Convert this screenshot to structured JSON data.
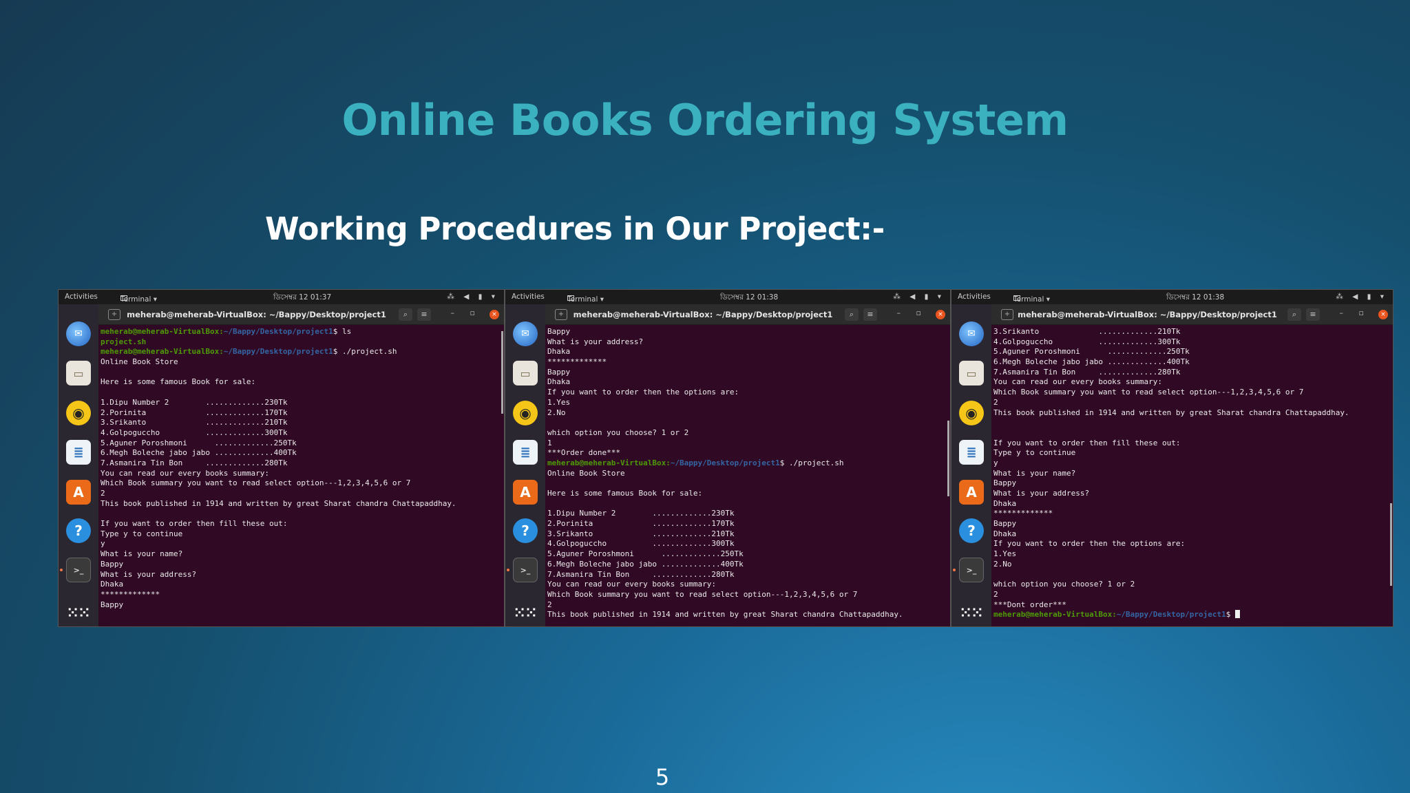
{
  "slide": {
    "title": "Online Books Ordering System",
    "subtitle": "Working Procedures in Our Project:-",
    "page_number": "5"
  },
  "common": {
    "activities": "Activities",
    "terminal_menu": "Terminal ▾",
    "window_title": "meherab@meherab-VirtualBox: ~/Bappy/Desktop/project1",
    "prompt_user": "meherab@meherab-VirtualBox",
    "prompt_path": "~/Bappy/Desktop/project1",
    "tray_icons": "⁂ ◀ ▮ ▾"
  },
  "screenshots": [
    {
      "clock": "ডিসেম্বর 12  01:37",
      "lines": [
        {
          "type": "prompt",
          "cmd": " ls"
        },
        {
          "type": "green",
          "text": "project.sh"
        },
        {
          "type": "prompt",
          "cmd": " ./project.sh"
        },
        {
          "type": "text",
          "text": "Online Book Store"
        },
        {
          "type": "text",
          "text": ""
        },
        {
          "type": "text",
          "text": "Here is some famous Book for sale:"
        },
        {
          "type": "text",
          "text": ""
        },
        {
          "type": "text",
          "text": "1.Dipu Number 2        .............230Tk"
        },
        {
          "type": "text",
          "text": "2.Porinita             .............170Tk"
        },
        {
          "type": "text",
          "text": "3.Srikanto             .............210Tk"
        },
        {
          "type": "text",
          "text": "4.Golpoguccho          .............300Tk"
        },
        {
          "type": "text",
          "text": "5.Aguner Poroshmoni      .............250Tk"
        },
        {
          "type": "text",
          "text": "6.Megh Boleche jabo jabo .............400Tk"
        },
        {
          "type": "text",
          "text": "7.Asmanira Tin Bon     .............280Tk"
        },
        {
          "type": "text",
          "text": "You can read our every books summary:"
        },
        {
          "type": "text",
          "text": "Which Book summary you want to read select option---1,2,3,4,5,6 or 7"
        },
        {
          "type": "text",
          "text": "2"
        },
        {
          "type": "text",
          "text": "This book published in 1914 and written by great Sharat chandra Chattapaddhay."
        },
        {
          "type": "text",
          "text": ""
        },
        {
          "type": "text",
          "text": "If you want to order then fill these out:"
        },
        {
          "type": "text",
          "text": "Type y to continue"
        },
        {
          "type": "text",
          "text": "y"
        },
        {
          "type": "text",
          "text": "What is your name?"
        },
        {
          "type": "text",
          "text": "Bappy"
        },
        {
          "type": "text",
          "text": "What is your address?"
        },
        {
          "type": "text",
          "text": "Dhaka"
        },
        {
          "type": "text",
          "text": "*************"
        },
        {
          "type": "text",
          "text": "Bappy"
        }
      ]
    },
    {
      "clock": "ডিসেম্বর 12  01:38",
      "lines": [
        {
          "type": "text",
          "text": "Bappy"
        },
        {
          "type": "text",
          "text": "What is your address?"
        },
        {
          "type": "text",
          "text": "Dhaka"
        },
        {
          "type": "text",
          "text": "*************"
        },
        {
          "type": "text",
          "text": "Bappy"
        },
        {
          "type": "text",
          "text": "Dhaka"
        },
        {
          "type": "text",
          "text": "If you want to order then the options are:"
        },
        {
          "type": "text",
          "text": "1.Yes"
        },
        {
          "type": "text",
          "text": "2.No"
        },
        {
          "type": "text",
          "text": ""
        },
        {
          "type": "text",
          "text": "which option you choose? 1 or 2"
        },
        {
          "type": "text",
          "text": "1"
        },
        {
          "type": "text",
          "text": "***Order done***"
        },
        {
          "type": "prompt",
          "cmd": " ./project.sh"
        },
        {
          "type": "text",
          "text": "Online Book Store"
        },
        {
          "type": "text",
          "text": ""
        },
        {
          "type": "text",
          "text": "Here is some famous Book for sale:"
        },
        {
          "type": "text",
          "text": ""
        },
        {
          "type": "text",
          "text": "1.Dipu Number 2        .............230Tk"
        },
        {
          "type": "text",
          "text": "2.Porinita             .............170Tk"
        },
        {
          "type": "text",
          "text": "3.Srikanto             .............210Tk"
        },
        {
          "type": "text",
          "text": "4.Golpoguccho          .............300Tk"
        },
        {
          "type": "text",
          "text": "5.Aguner Poroshmoni      .............250Tk"
        },
        {
          "type": "text",
          "text": "6.Megh Boleche jabo jabo .............400Tk"
        },
        {
          "type": "text",
          "text": "7.Asmanira Tin Bon     .............280Tk"
        },
        {
          "type": "text",
          "text": "You can read our every books summary:"
        },
        {
          "type": "text",
          "text": "Which Book summary you want to read select option---1,2,3,4,5,6 or 7"
        },
        {
          "type": "text",
          "text": "2"
        },
        {
          "type": "text",
          "text": "This book published in 1914 and written by great Sharat chandra Chattapaddhay."
        }
      ]
    },
    {
      "clock": "ডিসেম্বর 12  01:38",
      "lines": [
        {
          "type": "text",
          "text": "3.Srikanto             .............210Tk"
        },
        {
          "type": "text",
          "text": "4.Golpoguccho          .............300Tk"
        },
        {
          "type": "text",
          "text": "5.Aguner Poroshmoni      .............250Tk"
        },
        {
          "type": "text",
          "text": "6.Megh Boleche jabo jabo .............400Tk"
        },
        {
          "type": "text",
          "text": "7.Asmanira Tin Bon     .............280Tk"
        },
        {
          "type": "text",
          "text": "You can read our every books summary:"
        },
        {
          "type": "text",
          "text": "Which Book summary you want to read select option---1,2,3,4,5,6 or 7"
        },
        {
          "type": "text",
          "text": "2"
        },
        {
          "type": "text",
          "text": "This book published in 1914 and written by great Sharat chandra Chattapaddhay."
        },
        {
          "type": "text",
          "text": ""
        },
        {
          "type": "text",
          "text": ""
        },
        {
          "type": "text",
          "text": "If you want to order then fill these out:"
        },
        {
          "type": "text",
          "text": "Type y to continue"
        },
        {
          "type": "text",
          "text": "y"
        },
        {
          "type": "text",
          "text": "What is your name?"
        },
        {
          "type": "text",
          "text": "Bappy"
        },
        {
          "type": "text",
          "text": "What is your address?"
        },
        {
          "type": "text",
          "text": "Dhaka"
        },
        {
          "type": "text",
          "text": "*************"
        },
        {
          "type": "text",
          "text": "Bappy"
        },
        {
          "type": "text",
          "text": "Dhaka"
        },
        {
          "type": "text",
          "text": "If you want to order then the options are:"
        },
        {
          "type": "text",
          "text": "1.Yes"
        },
        {
          "type": "text",
          "text": "2.No"
        },
        {
          "type": "text",
          "text": ""
        },
        {
          "type": "text",
          "text": "which option you choose? 1 or 2"
        },
        {
          "type": "text",
          "text": "2"
        },
        {
          "type": "text",
          "text": "***Dont order***"
        },
        {
          "type": "prompt_cursor",
          "cmd": " "
        }
      ]
    }
  ]
}
